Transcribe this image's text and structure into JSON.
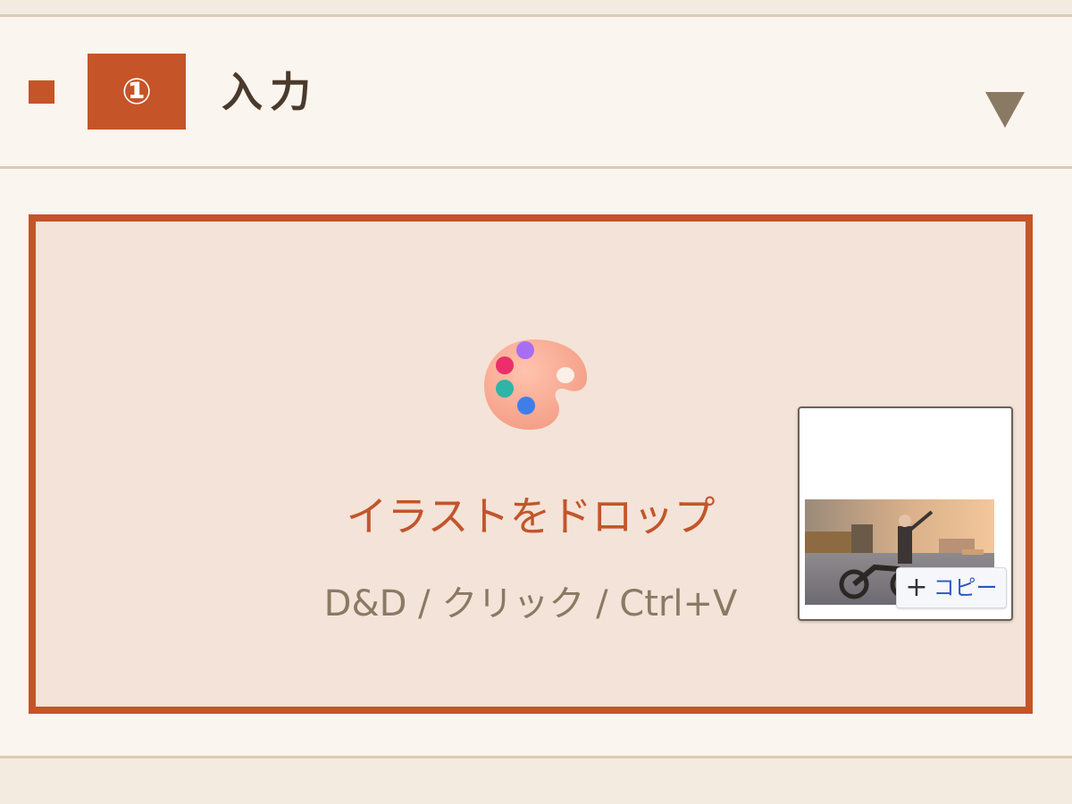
{
  "section": {
    "step_number": "①",
    "title": "入力"
  },
  "dropzone": {
    "icon": "palette-icon",
    "title": "イラストをドロップ",
    "hint": "D&D / クリック / Ctrl+V"
  },
  "drag_preview": {
    "badge_label": "コピー",
    "badge_icon": "plus-icon"
  },
  "colors": {
    "accent": "#c55428",
    "panel_background": "#faf5ee",
    "dropzone_background": "#f4e3d8",
    "title_text": "#4a3a2c",
    "muted_text": "#8a7a64"
  }
}
